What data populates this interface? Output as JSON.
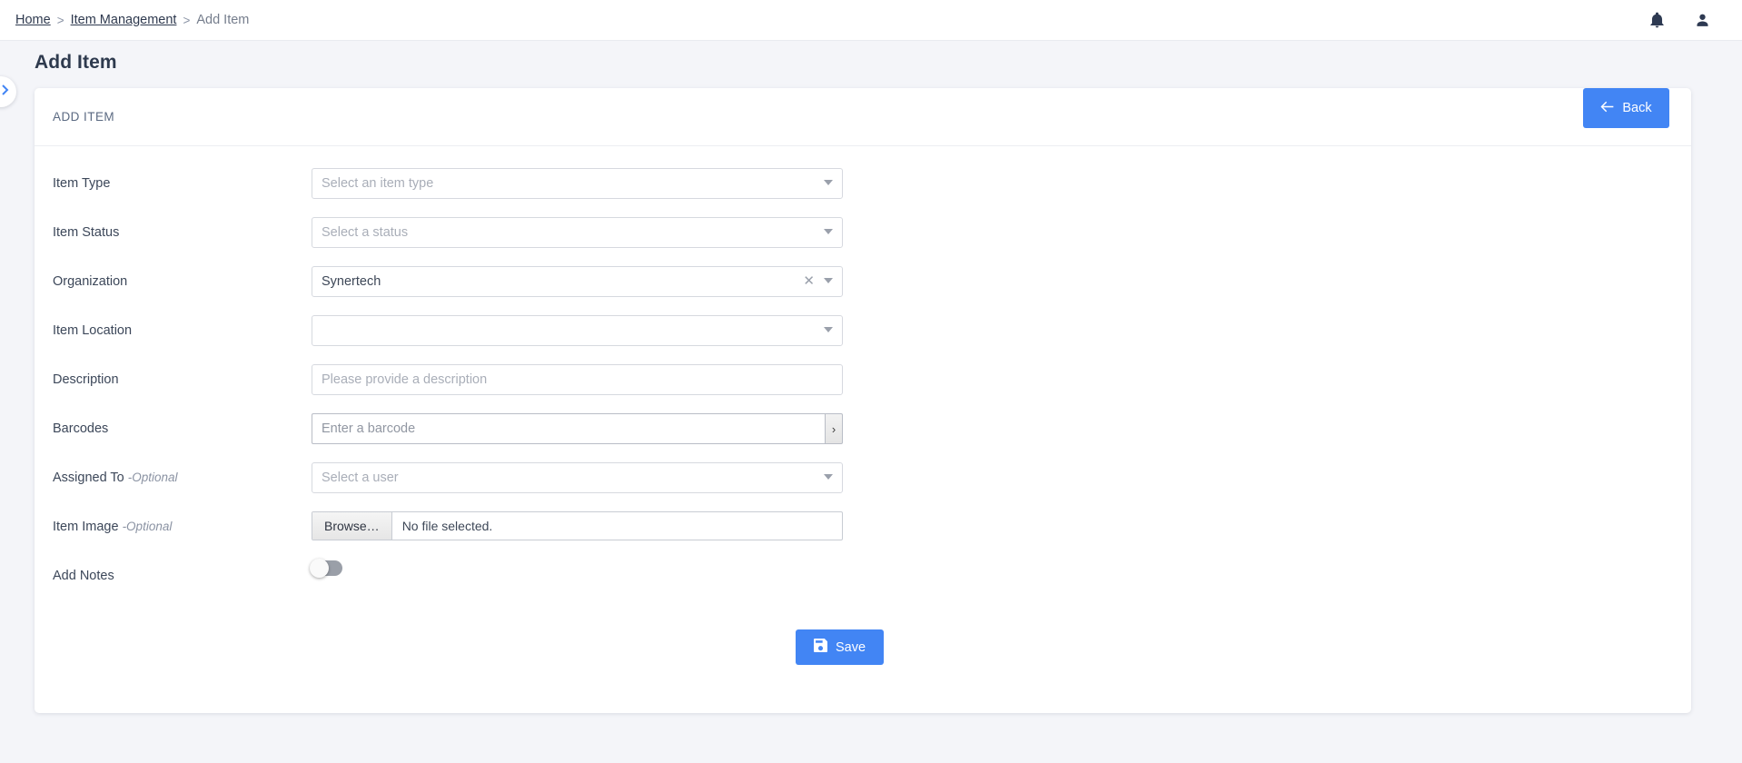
{
  "topbar": {
    "breadcrumb": [
      {
        "label": "Home",
        "type": "link"
      },
      {
        "label": "Item Management",
        "type": "link"
      },
      {
        "label": "Add Item",
        "type": "current"
      }
    ],
    "separator": ">",
    "notifications_icon": "bell-icon",
    "account_icon": "user-icon"
  },
  "page": {
    "title": "Add Item",
    "sidebar_toggle_icon": "chevron-right-icon",
    "accent_color": "#4285f4",
    "background_color": "#f4f5f9"
  },
  "card": {
    "header_title": "ADD ITEM",
    "back_button": {
      "label": "Back",
      "icon": "arrow-left-icon"
    },
    "save_button": {
      "label": "Save",
      "icon": "save-floppy-icon"
    }
  },
  "form": {
    "item_type": {
      "label": "Item Type",
      "placeholder": "Select an item type",
      "value": "",
      "control": "select"
    },
    "item_status": {
      "label": "Item Status",
      "placeholder": "Select a status",
      "value": "",
      "control": "select"
    },
    "organization": {
      "label": "Organization",
      "value": "Synertech",
      "clear_icon": "close-x-icon",
      "control": "select"
    },
    "item_location": {
      "label": "Item Location",
      "placeholder": "",
      "value": "",
      "control": "select"
    },
    "description": {
      "label": "Description",
      "placeholder": "Please provide a description",
      "value": "",
      "control": "text"
    },
    "barcodes": {
      "label": "Barcodes",
      "placeholder": "Enter a barcode",
      "value": "",
      "button_icon": "chevron-right-small",
      "button_label": "›"
    },
    "assigned_to": {
      "label": "Assigned To",
      "optional_label": "-Optional",
      "placeholder": "Select a user",
      "value": "",
      "control": "select"
    },
    "item_image": {
      "label": "Item Image",
      "optional_label": "-Optional",
      "browse_label": "Browse…",
      "file_status": "No file selected."
    },
    "add_notes": {
      "label": "Add Notes",
      "state": "off"
    }
  }
}
